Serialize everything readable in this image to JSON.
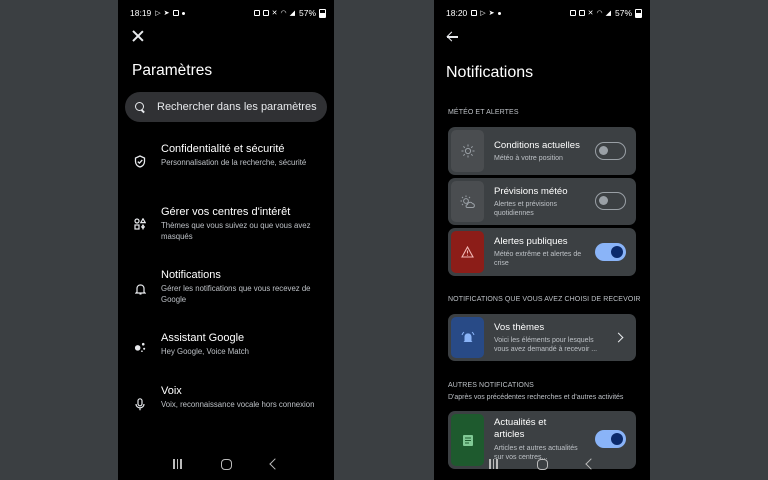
{
  "left": {
    "status": {
      "time": "18:19",
      "battery": "57%"
    },
    "title": "Paramètres",
    "search": {
      "placeholder": "Rechercher dans les paramètres"
    },
    "items": [
      {
        "icon": "shield-check-icon",
        "title": "Confidentialité et sécurité",
        "subtitle": "Personnalisation de la recherche, sécurité"
      },
      {
        "icon": "interests-icon",
        "title": "Gérer vos centres d'intérêt",
        "subtitle": "Thèmes que vous suivez ou que vous avez masqués"
      },
      {
        "icon": "bell-icon",
        "title": "Notifications",
        "subtitle": "Gérer les notifications que vous recevez de Google"
      },
      {
        "icon": "assistant-icon",
        "title": "Assistant Google",
        "subtitle": "Hey Google, Voice Match"
      },
      {
        "icon": "microphone-icon",
        "title": "Voix",
        "subtitle": "Voix, reconnaissance vocale hors connexion"
      }
    ]
  },
  "right": {
    "status": {
      "time": "18:20",
      "battery": "57%"
    },
    "title": "Notifications",
    "sections": {
      "weather": "MÉTÉO ET ALERTES",
      "chosen": "NOTIFICATIONS QUE VOUS AVEZ CHOISI DE RECEVOIR",
      "other": "AUTRES NOTIFICATIONS",
      "other_sub": "D'après vos précédentes recherches et d'autres activités"
    },
    "cards": [
      {
        "icon": "sun-icon",
        "title": "Conditions actuelles",
        "subtitle": "Météo à votre position",
        "toggle": "off"
      },
      {
        "icon": "sun-cloud-icon",
        "title": "Prévisions météo",
        "subtitle": "Alertes et prévisions quotidiennes",
        "toggle": "off"
      },
      {
        "icon": "warning-icon",
        "title": "Alertes publiques",
        "subtitle": "Météo extrême et alertes de crise",
        "toggle": "on"
      },
      {
        "icon": "bell-ring-icon",
        "title": "Vos thèmes",
        "subtitle": "Voici les éléments pour lesquels vous avez demandé à recevoir ...",
        "toggle": "chevron"
      },
      {
        "icon": "article-icon",
        "title": "Actualités et articles",
        "subtitle": "Articles et autres actualités sur vos centres...",
        "toggle": "on"
      }
    ]
  },
  "colors": {
    "background": "#3b3f42",
    "card": "#3c4043",
    "toggle_on": "#8ab4f8",
    "alert_thumb": "#8c1d18",
    "topics_thumb": "#284a86",
    "articles_thumb": "#1e5a2e"
  }
}
